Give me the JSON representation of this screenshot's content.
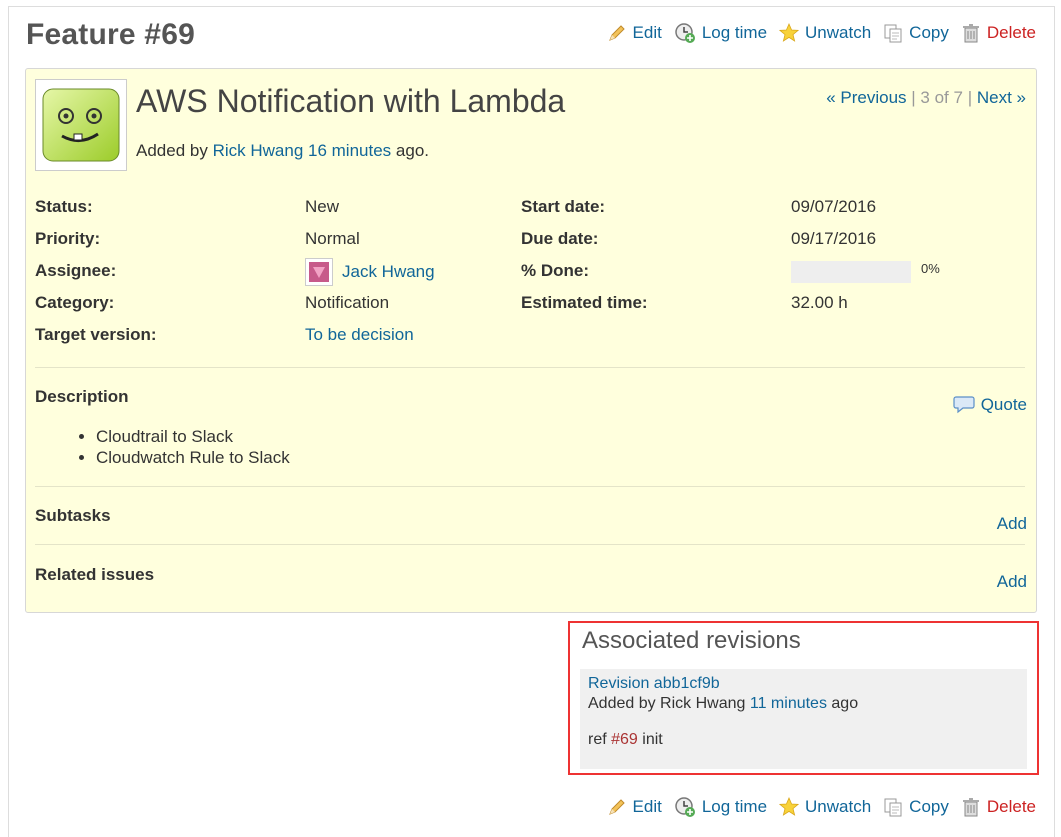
{
  "page": {
    "title": "Feature #69"
  },
  "actions": {
    "edit": "Edit",
    "log_time": "Log time",
    "unwatch": "Unwatch",
    "copy": "Copy",
    "delete": "Delete"
  },
  "issue": {
    "subject": "AWS Notification with Lambda",
    "added_by_prefix": "Added by",
    "author": "Rick Hwang",
    "time_ago": "16 minutes",
    "added_suffix": "ago.",
    "pager": {
      "previous": "« Previous",
      "position": "3 of 7",
      "next": "Next »",
      "divider": "|"
    }
  },
  "attributes": {
    "status": {
      "label": "Status:",
      "value": "New"
    },
    "priority": {
      "label": "Priority:",
      "value": "Normal"
    },
    "assignee": {
      "label": "Assignee:",
      "value": "Jack Hwang"
    },
    "category": {
      "label": "Category:",
      "value": "Notification"
    },
    "target_version": {
      "label": "Target version:",
      "value": "To be decision"
    },
    "start_date": {
      "label": "Start date:",
      "value": "09/07/2016"
    },
    "due_date": {
      "label": "Due date:",
      "value": "09/17/2016"
    },
    "done": {
      "label": "% Done:",
      "value": "0%",
      "fraction": 0
    },
    "estimated": {
      "label": "Estimated time:",
      "value": "32.00 h"
    }
  },
  "description": {
    "title": "Description",
    "quote": "Quote",
    "items": [
      "Cloudtrail to Slack",
      "Cloudwatch Rule to Slack"
    ]
  },
  "subtasks": {
    "title": "Subtasks",
    "add": "Add"
  },
  "related": {
    "title": "Related issues",
    "add": "Add"
  },
  "revisions": {
    "title": "Associated revisions",
    "revision_link": "Revision abb1cf9b",
    "added_by_prefix": "Added by Rick Hwang",
    "time_ago": "11 minutes",
    "suffix": "ago",
    "message_prefix": "ref",
    "issue_ref": "#69",
    "message_suffix": "init"
  },
  "colors": {
    "link": "#116699",
    "delete": "#cc2222",
    "issue_bg": "#ffffdd",
    "highlight_border": "#ee3333"
  }
}
